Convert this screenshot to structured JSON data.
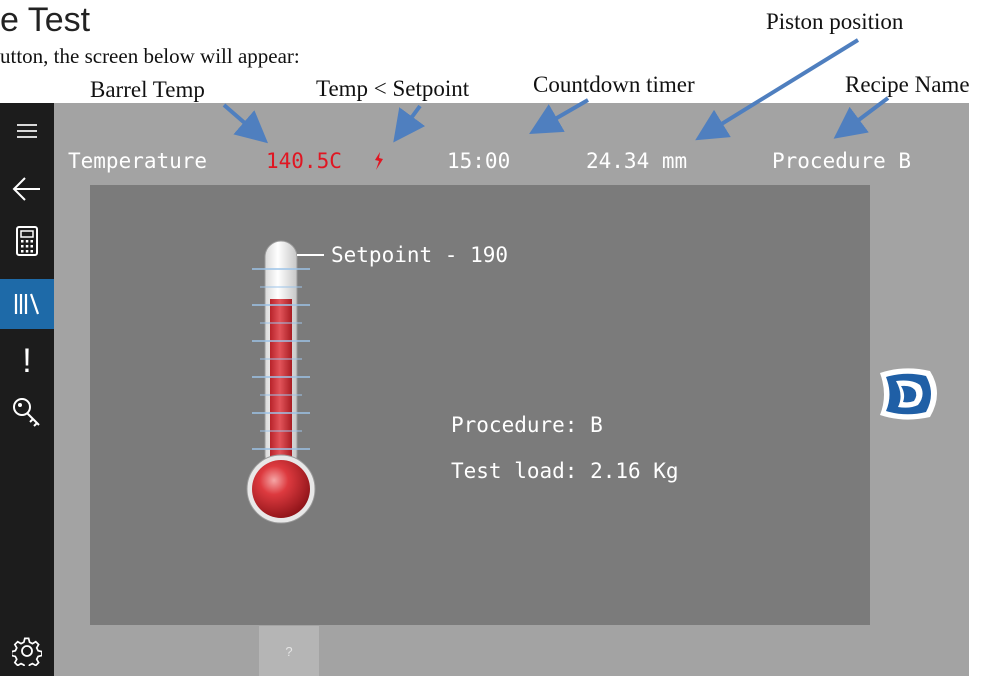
{
  "doc": {
    "title": "e Test",
    "subtitle": "utton, the screen below will appear:"
  },
  "callouts": {
    "barrel_temp": "Barrel Temp",
    "temp_lt_setpoint": "Temp < Setpoint",
    "countdown_timer": "Countdown timer",
    "piston_position": "Piston position",
    "recipe_name": "Recipe Name"
  },
  "sidebar": {
    "items": [
      {
        "icon": "hamburger-menu-icon"
      },
      {
        "icon": "back-arrow-icon"
      },
      {
        "icon": "calculator-icon"
      },
      {
        "icon": "library-icon",
        "active": true
      },
      {
        "icon": "alert-icon",
        "label": "!"
      },
      {
        "icon": "key-icon"
      },
      {
        "icon": "gear-icon"
      }
    ]
  },
  "topbar": {
    "temperature_label": "Temperature",
    "temperature_value": "140.5C",
    "timer": "15:00",
    "piston": "24.34 mm",
    "recipe": "Procedure B"
  },
  "panel": {
    "setpoint": "Setpoint - 190",
    "procedure": "Procedure: B",
    "test_load": "Test load: 2.16 Kg"
  },
  "bottom_tab": {
    "label": "?"
  },
  "colors": {
    "app_bg": "#a3a3a3",
    "panel_bg": "#7b7b7b",
    "sidebar_bg": "#1c1c1c",
    "active_blue": "#1e6aa8",
    "temp_red": "#e01622",
    "arrow_blue": "#4f7fbf"
  }
}
